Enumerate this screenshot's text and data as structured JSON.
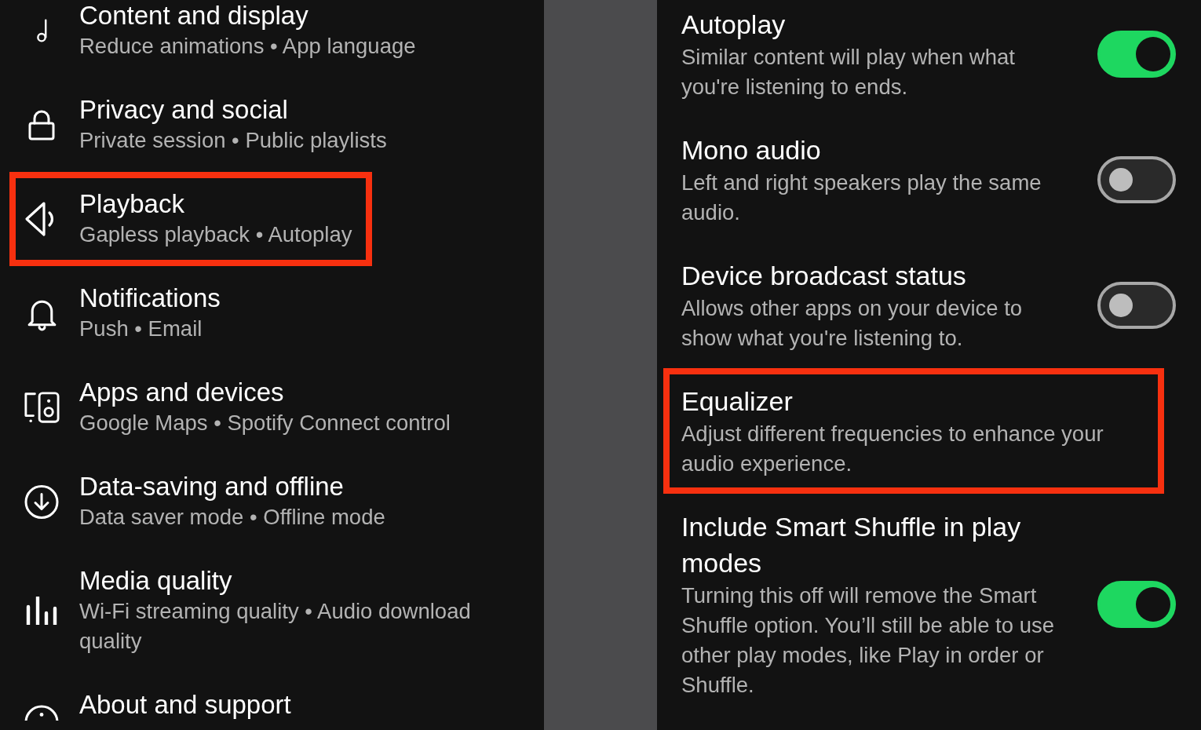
{
  "settings_menu": {
    "items": [
      {
        "title": "Content and display",
        "subtitle": "Reduce animations • App language",
        "highlighted": false
      },
      {
        "title": "Privacy and social",
        "subtitle": "Private session • Public playlists",
        "highlighted": false
      },
      {
        "title": "Playback",
        "subtitle": "Gapless playback • Autoplay",
        "highlighted": true
      },
      {
        "title": "Notifications",
        "subtitle": "Push • Email",
        "highlighted": false
      },
      {
        "title": "Apps and devices",
        "subtitle": "Google Maps • Spotify Connect control",
        "highlighted": false
      },
      {
        "title": "Data-saving and offline",
        "subtitle": "Data saver mode • Offline mode",
        "highlighted": false
      },
      {
        "title": "Media quality",
        "subtitle": "Wi-Fi streaming quality • Audio download quality",
        "highlighted": false
      },
      {
        "title": "About and support",
        "highlighted": false
      }
    ]
  },
  "playback_settings": {
    "settings": [
      {
        "kind": "toggle",
        "title": "Autoplay",
        "description": "Similar content will play when what you're listening to ends.",
        "on": true,
        "highlighted": false
      },
      {
        "kind": "toggle",
        "title": "Mono audio",
        "description": "Left and right speakers play the same audio.",
        "on": false,
        "highlighted": false
      },
      {
        "kind": "toggle",
        "title": "Device broadcast status",
        "description": "Allows other apps on your device to show what you're listening to.",
        "on": false,
        "highlighted": false
      },
      {
        "kind": "link",
        "title": "Equalizer",
        "description": "Adjust different frequencies to enhance your audio experience.",
        "highlighted": true
      },
      {
        "kind": "toggle",
        "title": "Include Smart Shuffle in play modes",
        "description": "Turning this off will remove the Smart Shuffle option. You’ll still be able to use other play modes, like Play in order or Shuffle.",
        "on": true,
        "highlighted": false
      }
    ]
  }
}
